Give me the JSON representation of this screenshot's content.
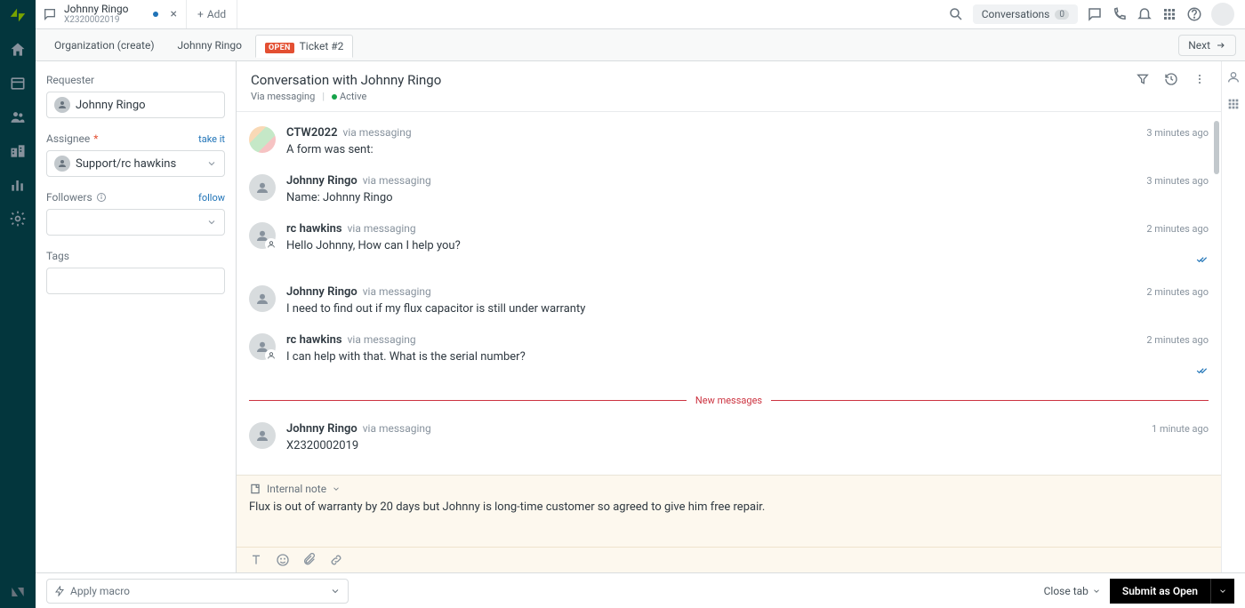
{
  "top": {
    "tab": {
      "title": "Johnny Ringo",
      "subtitle": "X2320002019"
    },
    "add": "Add",
    "conversations": {
      "label": "Conversations",
      "count": "0"
    }
  },
  "subtabs": {
    "org": "Organization (create)",
    "person": "Johnny Ringo",
    "ticket_badge": "OPEN",
    "ticket_label": "Ticket #2",
    "next": "Next"
  },
  "props": {
    "requester_label": "Requester",
    "requester_value": "Johnny Ringo",
    "assignee_label": "Assignee",
    "take_it": "take it",
    "assignee_value": "Support/rc hawkins",
    "followers_label": "Followers",
    "follow": "follow",
    "tags_label": "Tags"
  },
  "conv": {
    "title": "Conversation with Johnny Ringo",
    "via": "Via messaging",
    "status": "Active",
    "new_messages": "New messages",
    "messages": [
      {
        "author": "CTW2022",
        "via": "via messaging",
        "time": "3 minutes ago",
        "text": "A form was sent:",
        "avatar": "group",
        "checks": false
      },
      {
        "author": "Johnny Ringo",
        "via": "via messaging",
        "time": "3 minutes ago",
        "text": "Name: Johnny Ringo",
        "avatar": "user",
        "checks": false
      },
      {
        "author": "rc hawkins",
        "via": "via messaging",
        "time": "2 minutes ago",
        "text": "Hello Johnny, How can I help you?",
        "avatar": "agent",
        "checks": true
      },
      {
        "author": "Johnny Ringo",
        "via": "via messaging",
        "time": "2 minutes ago",
        "text": "I need to find out if my flux capacitor is still under warranty",
        "avatar": "user",
        "checks": false
      },
      {
        "author": "rc hawkins",
        "via": "via messaging",
        "time": "2 minutes ago",
        "text": "I can help with that. What is the serial number?",
        "avatar": "agent",
        "checks": true
      }
    ],
    "after_divider": [
      {
        "author": "Johnny Ringo",
        "via": "via messaging",
        "time": "1 minute ago",
        "text": "X2320002019",
        "avatar": "user",
        "checks": false
      }
    ]
  },
  "composer": {
    "mode": "Internal note",
    "text": "Flux is out of warranty by 20 days but Johnny is long-time customer so agreed to give him free repair."
  },
  "footer": {
    "macro": "Apply macro",
    "close_tab": "Close tab",
    "submit": "Submit as Open"
  }
}
